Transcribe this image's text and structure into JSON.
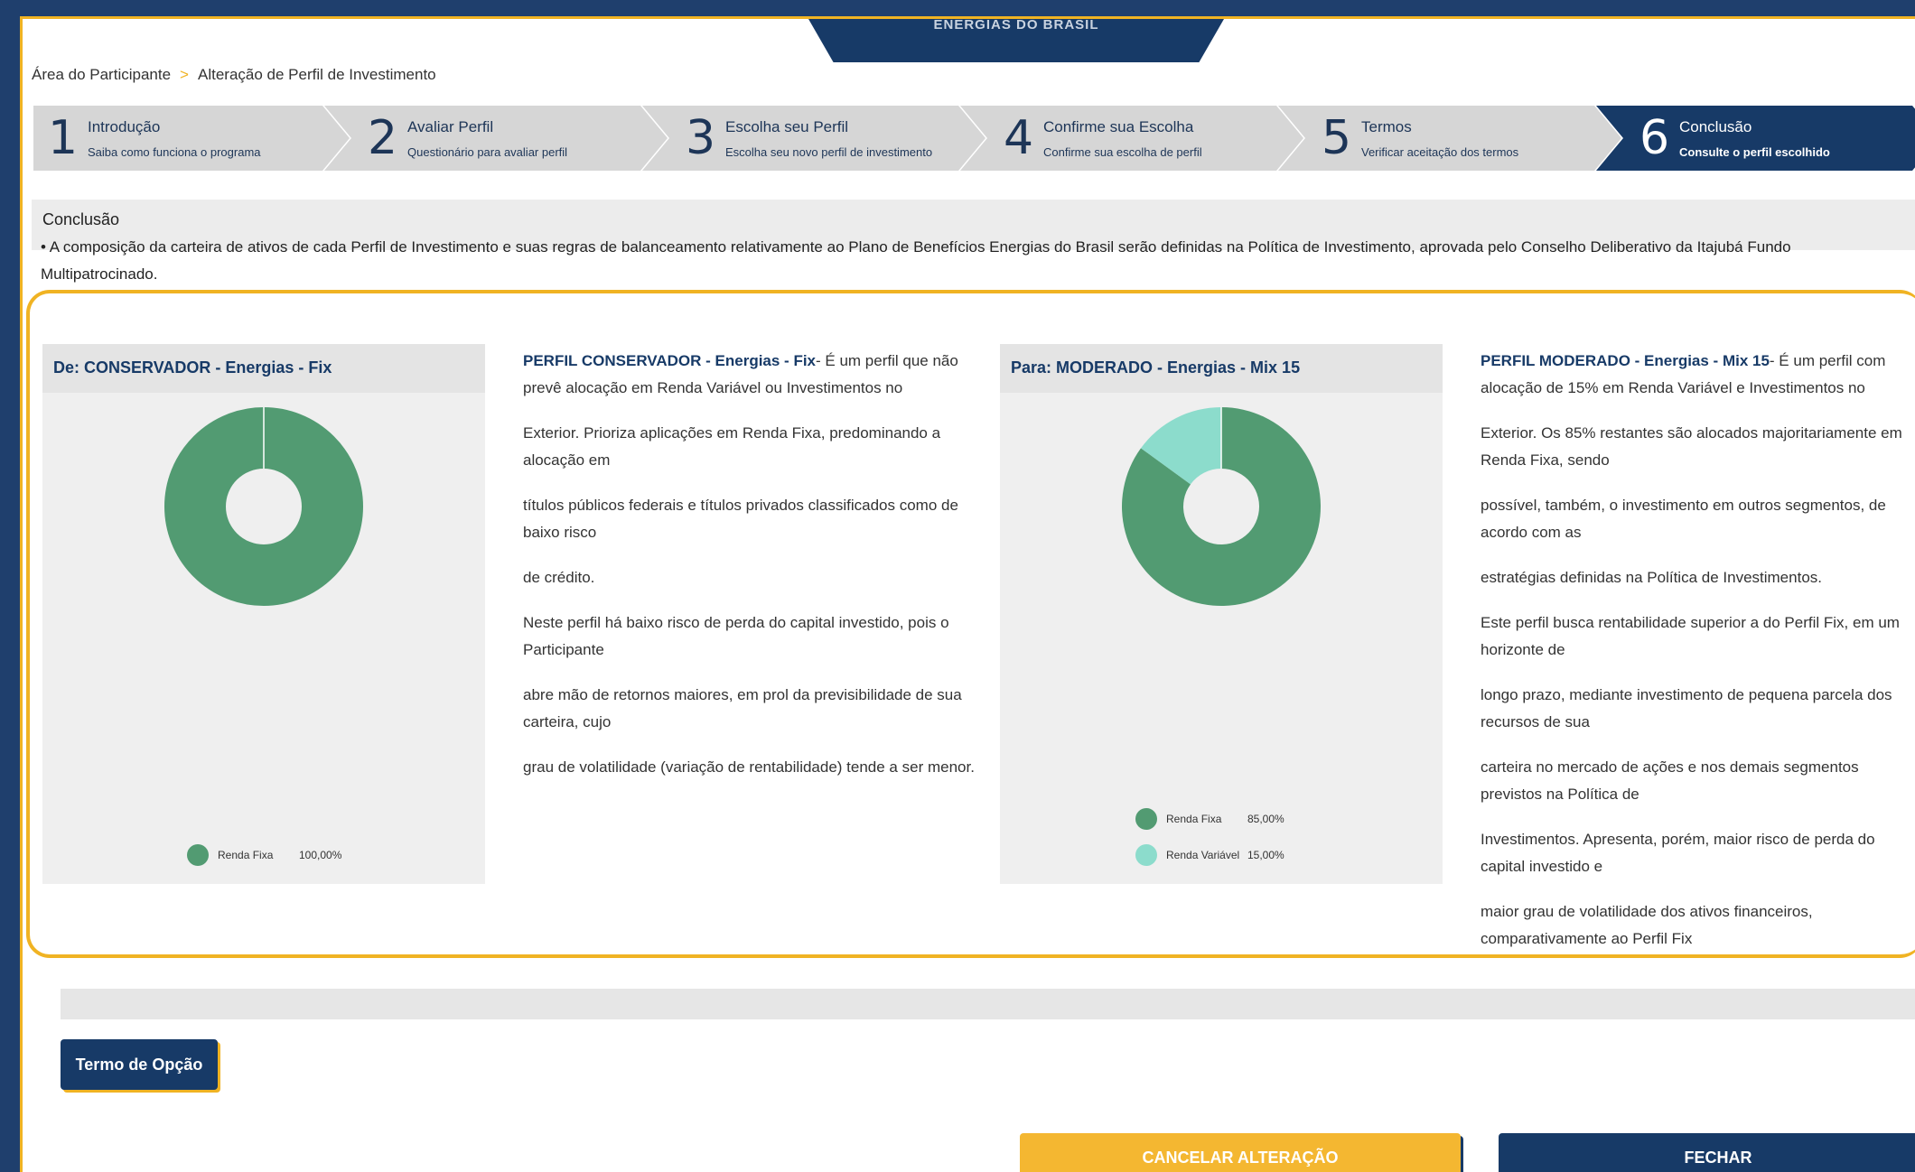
{
  "header": {
    "tab_label": "ENERGIAS DO BRASIL"
  },
  "breadcrumb": {
    "root": "Área do Participante",
    "separator": ">",
    "current": "Alteração de Perfil de Investimento"
  },
  "steps": [
    {
      "num": "1",
      "title": "Introdução",
      "sub": "Saiba como funciona o programa"
    },
    {
      "num": "2",
      "title": "Avaliar Perfil",
      "sub": "Questionário para avaliar perfil"
    },
    {
      "num": "3",
      "title": "Escolha seu Perfil",
      "sub": "Escolha seu novo perfil de investimento"
    },
    {
      "num": "4",
      "title": "Confirme sua Escolha",
      "sub": "Confirme sua escolha de perfil"
    },
    {
      "num": "5",
      "title": "Termos",
      "sub": "Verificar aceitação dos termos"
    },
    {
      "num": "6",
      "title": "Conclusão",
      "sub": "Consulte o perfil escolhido"
    }
  ],
  "conclusion": {
    "title": "Conclusão",
    "text": "• A composição da carteira de ativos de cada Perfil de Investimento e suas regras de balanceamento relativamente ao Plano de Benefícios Energias do Brasil serão definidas na Política de Investimento, aprovada pelo Conselho Deliberativo da Itajubá Fundo Multipatrocinado."
  },
  "from_profile": {
    "heading": "De: CONSERVADOR - Energias - Fix",
    "desc_bold": "PERFIL CONSERVADOR - Energias - Fix",
    "paragraphs": [
      "- É um perfil que não prevê alocação em Renda Variável ou Investimentos no",
      "Exterior. Prioriza aplicações em Renda Fixa, predominando a alocação em",
      "títulos públicos federais e títulos privados classificados como de baixo risco",
      "de crédito.",
      "Neste perfil há baixo risco de perda do capital investido, pois o Participante",
      "abre mão de retornos maiores, em prol da previsibilidade de sua carteira, cujo",
      "grau de volatilidade (variação de rentabilidade) tende a ser menor."
    ],
    "legend": [
      {
        "name": "Renda Fixa",
        "value": "100,00%"
      }
    ]
  },
  "to_profile": {
    "heading": "Para: MODERADO - Energias - Mix 15",
    "desc_bold": "PERFIL MODERADO - Energias - Mix 15",
    "paragraphs": [
      "- É um perfil com alocação de 15% em Renda Variável e Investimentos no",
      "Exterior. Os 85% restantes são alocados majoritariamente em Renda Fixa, sendo",
      "possível, também, o investimento em outros segmentos, de acordo com as",
      "estratégias definidas na Política de Investimentos.",
      "Este perfil busca rentabilidade superior a do Perfil Fix, em um horizonte de",
      "longo prazo, mediante investimento de pequena parcela dos recursos de sua",
      "carteira no mercado de ações e nos demais segmentos previstos na Política de",
      "Investimentos. Apresenta, porém, maior risco de perda do capital investido e",
      "maior grau de volatilidade dos ativos financeiros, comparativamente ao Perfil Fix"
    ],
    "legend": [
      {
        "name": "Renda Fixa",
        "value": "85,00%"
      },
      {
        "name": "Renda Variável",
        "value": "15,00%"
      }
    ]
  },
  "chart_data": [
    {
      "type": "pie",
      "donut": true,
      "categories": [
        "Renda Fixa"
      ],
      "values": [
        100
      ],
      "colors": [
        "#529b72"
      ]
    },
    {
      "type": "pie",
      "donut": true,
      "categories": [
        "Renda Fixa",
        "Renda Variável"
      ],
      "values": [
        85,
        15
      ],
      "colors": [
        "#529b72",
        "#8cdccc"
      ]
    }
  ],
  "buttons": {
    "termo": "Termo de Opção",
    "cancel": "CANCELAR ALTERAÇÃO",
    "close": "FECHAR"
  },
  "colors": {
    "navy": "#173a67",
    "accent": "#f0b323",
    "renda_fixa": "#529b72",
    "renda_variavel": "#8cdccc"
  }
}
